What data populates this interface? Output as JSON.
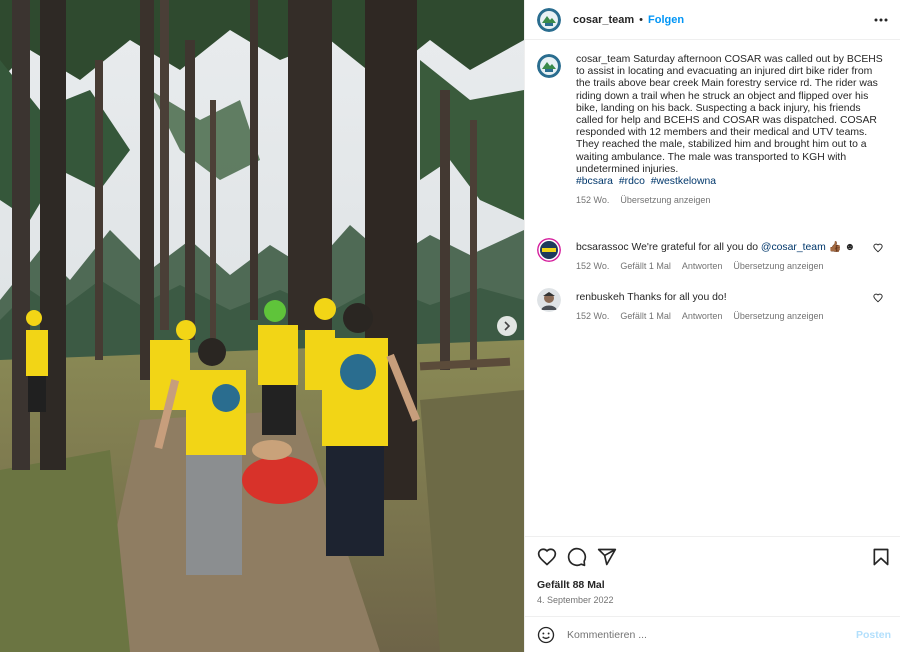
{
  "post": {
    "username": "cosar_team",
    "separator": "•",
    "follow_label": "Folgen",
    "more_icon": "more-horizontal-icon"
  },
  "caption": {
    "username": "cosar_team",
    "text": "Saturday afternoon COSAR was called out by BCEHS to assist in locating and evacuating an injured dirt bike rider from the trails above bear creek Main forestry service rd. The rider was riding down a trail when he struck an object and flipped over his bike, landing on his back. Suspecting a back injury, his friends called for help and BCEHS and COSAR was dispatched. COSAR responded with 12 members and their medical and UTV teams. They reached the male, stabilized him and brought him out to a waiting ambulance. The male was transported to KGH with undetermined injuries.",
    "hashtags": [
      "#bcsara",
      "#rdco",
      "#westkelowna"
    ],
    "age": "152 Wo.",
    "translate_label": "Übersetzung anzeigen"
  },
  "comments": [
    {
      "username": "bcsarassoc",
      "text_before": "We're grateful for all you do",
      "mention": "@cosar_team",
      "text_after": "👍🏾 ☻",
      "age": "152 Wo.",
      "likes_label": "Gefällt 1 Mal",
      "reply_label": "Antworten",
      "translate_label": "Übersetzung anzeigen"
    },
    {
      "username": "renbuskeh",
      "text": "Thanks for all you do!",
      "age": "152 Wo.",
      "likes_label": "Gefällt 1 Mal",
      "reply_label": "Antworten",
      "translate_label": "Übersetzung anzeigen"
    }
  ],
  "stats": {
    "likes": "Gefällt 88 Mal",
    "date": "4. September 2022"
  },
  "compose": {
    "placeholder": "Kommentieren ...",
    "post_label": "Posten"
  },
  "colors": {
    "link_blue": "#0095f6",
    "hashtag_blue": "#00376b",
    "muted_gray": "#737373",
    "vest_yellow": "#f5d90a"
  }
}
